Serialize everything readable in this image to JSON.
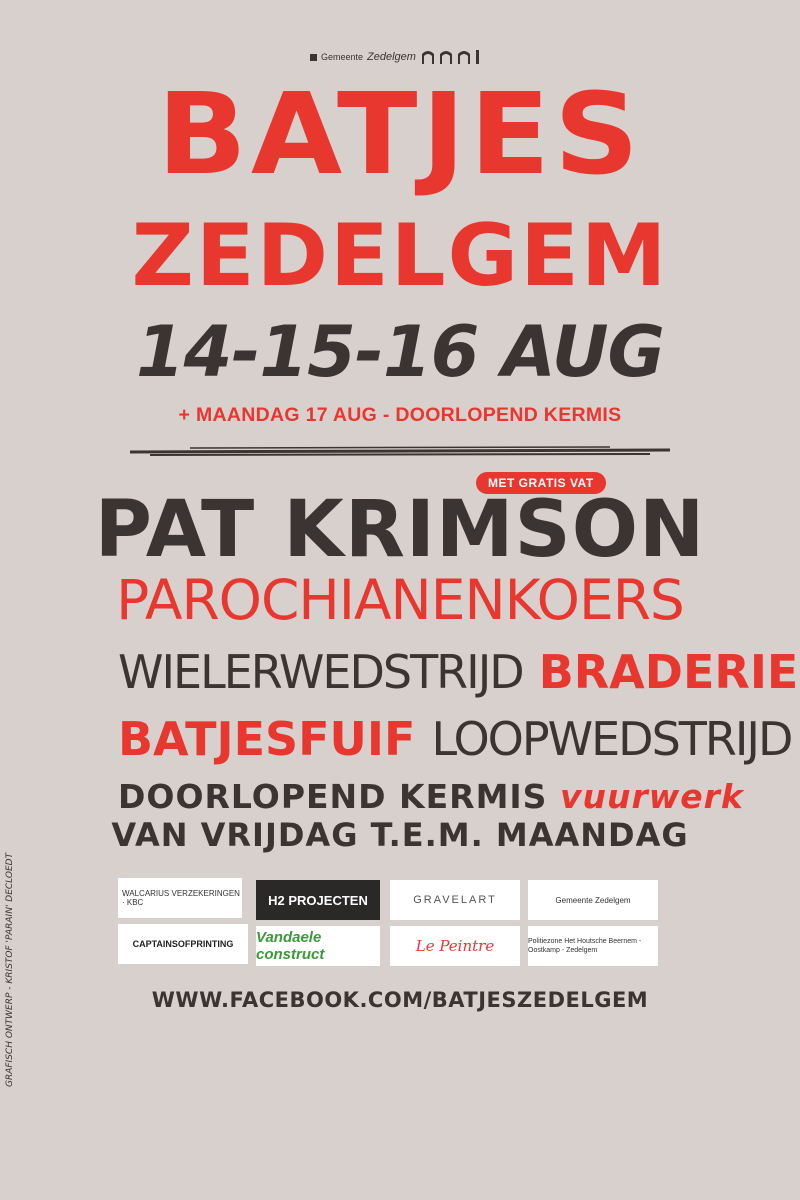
{
  "top_logo": {
    "text": "Gemeente",
    "name": "Zedelgem"
  },
  "title": {
    "line1": "BATJES",
    "line2": "ZEDELGEM"
  },
  "dates": "14-15-16 AUG",
  "subdate": "+ MAANDAG 17 AUG - DOORLOPEND KERMIS",
  "badge": "MET GRATIS VAT",
  "lineup": {
    "l1": "PAT KRIMSON",
    "l2": "PAROCHIANENKOERS",
    "l3a": "WIELERWEDSTRIJD",
    "l3b": "BRADERIE",
    "l4a": "BATJESFUIF",
    "l4b": "LOOPWEDSTRIJD",
    "l5a": "DOORLOPEND KERMIS",
    "l5b": "vuurwerk",
    "l6": "VAN VRIJDAG T.E.M. MAANDAG"
  },
  "sponsors": {
    "s1": "WALCARIUS VERZEKERINGEN · KBC",
    "s2": "H2 PROJECTEN",
    "s3": "GRAVELART",
    "s4": "Gemeente Zedelgem",
    "s5": "CAPTAINSOFPRINTING",
    "s6": "Vandaele construct",
    "s7": "Le Peintre",
    "s8": "Politiezone Het Houtsche Beernem - Oostkamp - Zedelgem"
  },
  "website": "WWW.FACEBOOK.COM/BATJESZEDELGEM",
  "credit": "GRAFISCH ONTWERP - KRISTOF 'PARAIN' DECLOEDT",
  "colors": {
    "background": "#d8d0cd",
    "red": "#e8372f",
    "dark": "#3a3432"
  }
}
